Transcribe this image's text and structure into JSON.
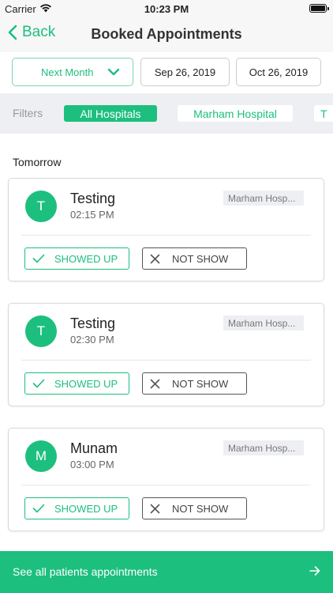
{
  "status_bar": {
    "carrier": "Carrier",
    "time": "10:23 PM"
  },
  "nav": {
    "back_label": "Back",
    "title": "Booked Appointments"
  },
  "date_filter": {
    "month_value": "Next Month",
    "from_date": "Sep 26, 2019",
    "to_date": "Oct 26, 2019"
  },
  "filters": {
    "label": "Filters",
    "chips": [
      {
        "label": "All Hospitals",
        "active": true
      },
      {
        "label": "Marham Hospital",
        "active": false
      },
      {
        "label": "T",
        "active": false
      }
    ]
  },
  "section": {
    "title": "Tomorrow"
  },
  "appointments": [
    {
      "initial": "T",
      "name": "Testing",
      "time": "02:15 PM",
      "hospital": "Marham Hosp...",
      "showed_label": "SHOWED UP",
      "not_show_label": "NOT SHOW"
    },
    {
      "initial": "T",
      "name": "Testing",
      "time": "02:30 PM",
      "hospital": "Marham Hosp...",
      "showed_label": "SHOWED UP",
      "not_show_label": "NOT SHOW"
    },
    {
      "initial": "M",
      "name": "Munam",
      "time": "03:00 PM",
      "hospital": "Marham Hosp...",
      "showed_label": "SHOWED UP",
      "not_show_label": "NOT SHOW"
    }
  ],
  "footer": {
    "label": "See all patients appointments"
  },
  "icons": {
    "wifi": "wifi-icon",
    "battery": "battery-icon",
    "back": "chevron-left-icon",
    "dropdown": "chevron-down-icon",
    "check": "check-icon",
    "close": "close-icon",
    "arrow": "arrow-right-icon"
  },
  "colors": {
    "accent": "#1dbf7e",
    "filter_bg": "#eeeff2",
    "tag_bg": "#eeeff2"
  }
}
